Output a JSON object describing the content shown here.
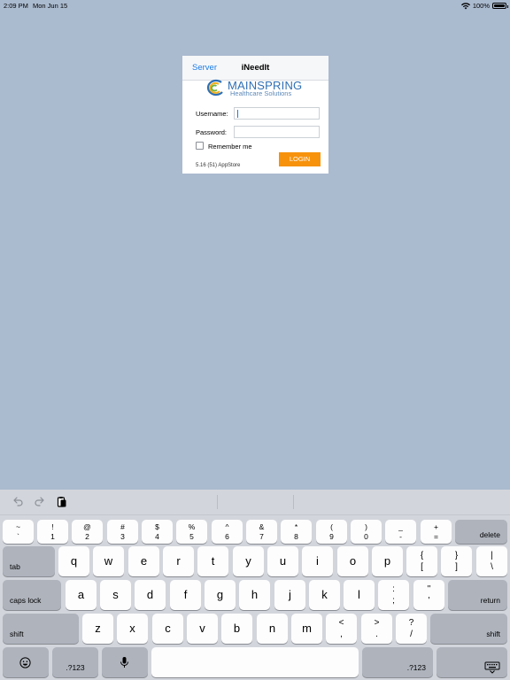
{
  "status_bar": {
    "time": "2:09 PM",
    "date": "Mon Jun 15",
    "battery": "100%"
  },
  "login": {
    "server_label": "Server",
    "title": "iNeedIt",
    "logo_name": "MAINSPRING",
    "logo_sub": "Healthcare Solutions",
    "username_label": "Username:",
    "password_label": "Password:",
    "username_value": "",
    "password_value": "",
    "remember_label": "Remember me",
    "remember_checked": false,
    "login_button": "LOGIN",
    "version": "5.16 (51) AppStore",
    "accent": "#f7920c",
    "link_color": "#1a7be8"
  },
  "keyboard": {
    "toolbar_icons": [
      "undo-icon",
      "redo-icon",
      "paste-icon"
    ],
    "rows": {
      "number_row": [
        {
          "top": "~",
          "bot": "`"
        },
        {
          "top": "!",
          "bot": "1"
        },
        {
          "top": "@",
          "bot": "2"
        },
        {
          "top": "#",
          "bot": "3"
        },
        {
          "top": "$",
          "bot": "4"
        },
        {
          "top": "%",
          "bot": "5"
        },
        {
          "top": "^",
          "bot": "6"
        },
        {
          "top": "&",
          "bot": "7"
        },
        {
          "top": "*",
          "bot": "8"
        },
        {
          "top": "(",
          "bot": "9"
        },
        {
          "top": ")",
          "bot": "0"
        },
        {
          "top": "_",
          "bot": "-"
        },
        {
          "top": "+",
          "bot": "="
        }
      ],
      "delete": "delete",
      "tab": "tab",
      "qwerty": [
        "q",
        "w",
        "e",
        "r",
        "t",
        "y",
        "u",
        "i",
        "o",
        "p"
      ],
      "tab_row_punct": [
        {
          "top": "{",
          "bot": "["
        },
        {
          "top": "}",
          "bot": "]"
        },
        {
          "top": "|",
          "bot": "\\"
        }
      ],
      "caps_lock": "caps lock",
      "home_row": [
        "a",
        "s",
        "d",
        "f",
        "g",
        "h",
        "j",
        "k",
        "l"
      ],
      "home_row_punct": [
        {
          "top": ":",
          "bot": ";"
        },
        {
          "top": "\"",
          "bot": "'"
        }
      ],
      "return": "return",
      "shift_left": "shift",
      "bottom_letters": [
        "z",
        "x",
        "c",
        "v",
        "b",
        "n",
        "m"
      ],
      "bottom_punct": [
        {
          "top": "<",
          "bot": ","
        },
        {
          "top": ">",
          "bot": "."
        },
        {
          "top": "?",
          "bot": "/"
        }
      ],
      "shift_right": "shift",
      "numbers_left": ".?123",
      "numbers_right": ".?123"
    }
  }
}
